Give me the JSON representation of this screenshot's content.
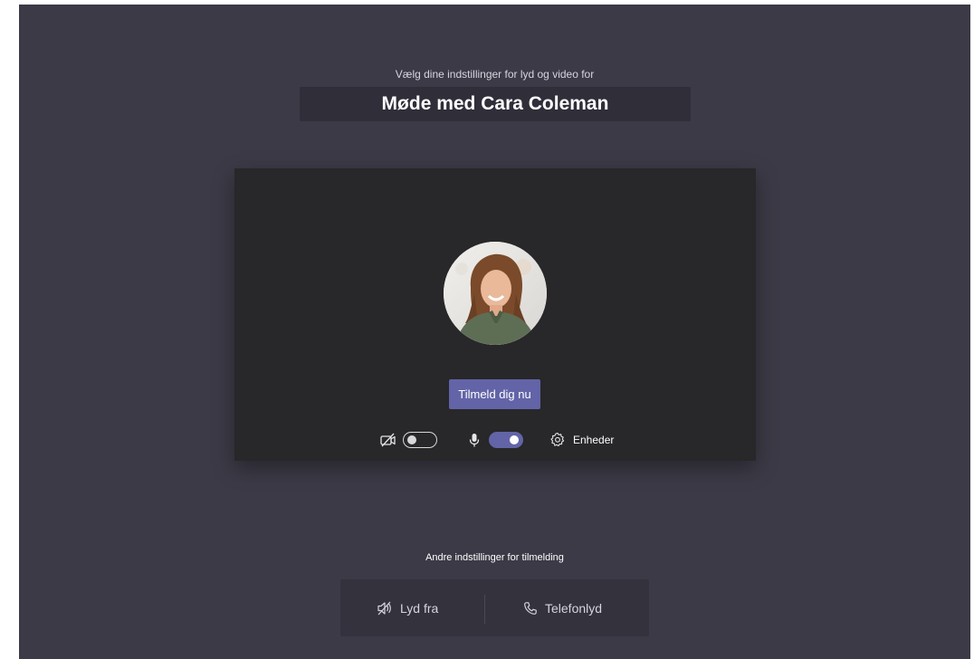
{
  "prejoin": {
    "subtitle": "Vælg dine indstillinger for lyd og video for",
    "meeting_title": "Møde med Cara Coleman"
  },
  "preview": {
    "join_label": "Tilmeld dig nu",
    "camera_on": false,
    "mic_on": true,
    "devices_label": "Enheder"
  },
  "other_options": {
    "title": "Andre indstillinger for tilmelding",
    "audio_off_label": "Lyd fra",
    "phone_audio_label": "Telefonlyd"
  },
  "colors": {
    "background": "#3b3a46",
    "preview_background": "#282729",
    "accent": "#6264a7"
  },
  "icons": [
    "camera-off-icon",
    "microphone-icon",
    "gear-icon",
    "speaker-off-icon",
    "phone-icon"
  ]
}
